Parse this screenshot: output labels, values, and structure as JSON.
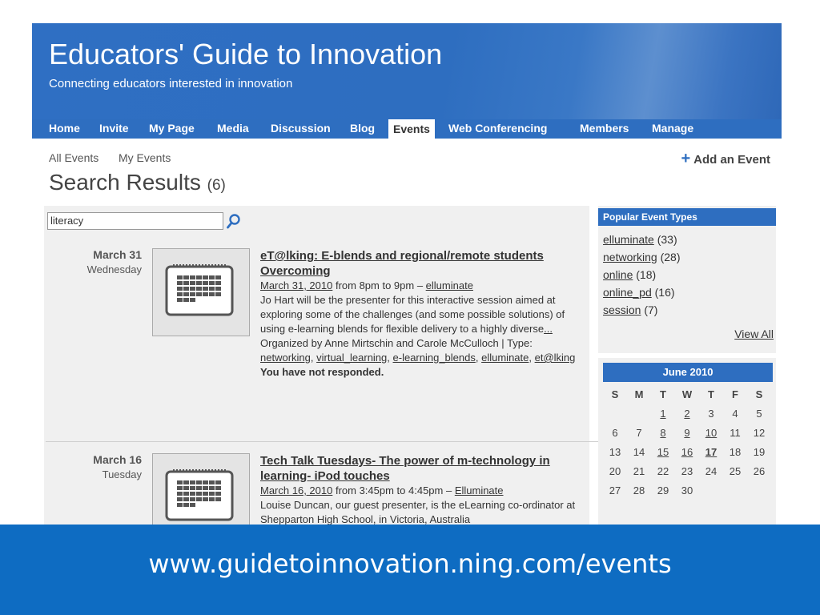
{
  "site": {
    "title": "Educators' Guide to Innovation",
    "tagline": "Connecting educators interested in innovation"
  },
  "nav": {
    "items": [
      {
        "label": "Home"
      },
      {
        "label": "Invite"
      },
      {
        "label": "My Page"
      },
      {
        "label": "Media"
      },
      {
        "label": "Discussion"
      },
      {
        "label": "Blog"
      },
      {
        "label": "Events",
        "active": true
      },
      {
        "label": "Web Conferencing"
      },
      {
        "label": "Members"
      },
      {
        "label": "Manage"
      }
    ]
  },
  "subnav": {
    "all_events": "All Events",
    "my_events": "My Events",
    "add_event": "Add an Event",
    "add_event_icon": "plus-icon"
  },
  "page": {
    "title": "Search Results",
    "count": "(6)"
  },
  "search": {
    "value": "literacy",
    "icon": "search-icon"
  },
  "events": [
    {
      "date": "March 31",
      "weekday": "Wednesday",
      "title": "eT@lking: E-blends and regional/remote students Overcoming",
      "when_link": "March 31, 2010",
      "when_text": " from 8pm to 9pm – ",
      "where_link": "elluminate",
      "description": "Jo Hart will be the presenter for this interactive session aimed at exploring some of the challenges (and some possible solutions) of using e-learning blends for flexible delivery to a highly diverse",
      "more": "...",
      "organized": "Organized by Anne Mirtschin and Carole McCulloch | Type: ",
      "types": [
        "networking",
        "virtual_learning",
        "e-learning_blends",
        "elluminate",
        "et@lking"
      ],
      "response": "You have not responded."
    },
    {
      "date": "March 16",
      "weekday": "Tuesday",
      "title": "Tech Talk Tuesdays- The power of m-technology in learning- iPod touches",
      "when_link": "March 16, 2010",
      "when_text": " from 3:45pm to 4:45pm – ",
      "where_link": "Elluminate",
      "description": "Louise Duncan, our guest presenter, is the eLearning co-ordinator at Shepparton High School, in Victoria, Australia"
    }
  ],
  "popular": {
    "heading": "Popular Event Types",
    "items": [
      {
        "name": "elluminate",
        "count": " (33)"
      },
      {
        "name": "networking",
        "count": " (28)"
      },
      {
        "name": "online",
        "count": " (18)"
      },
      {
        "name": "online_pd",
        "count": " (16)"
      },
      {
        "name": "session",
        "count": " (7)"
      }
    ],
    "view_all": "View All"
  },
  "calendar": {
    "month": "June 2010",
    "dow": [
      "S",
      "M",
      "T",
      "W",
      "T",
      "F",
      "S"
    ],
    "weeks": [
      [
        "",
        "",
        "1",
        "2",
        "3",
        "4",
        "5"
      ],
      [
        "6",
        "7",
        "8",
        "9",
        "10",
        "11",
        "12"
      ],
      [
        "13",
        "14",
        "15",
        "16",
        "17",
        "18",
        "19"
      ],
      [
        "20",
        "21",
        "22",
        "23",
        "24",
        "25",
        "26"
      ],
      [
        "27",
        "28",
        "29",
        "30",
        "",
        "",
        ""
      ]
    ],
    "linked_days": [
      "1",
      "2",
      "8",
      "9",
      "10",
      "15",
      "16",
      "17"
    ],
    "today": "17"
  },
  "banner": {
    "url": "www.guidetoinnovation.ning.com/events"
  },
  "colors": {
    "brand_blue": "#2e6ec0",
    "banner_blue": "#0e6cc2"
  }
}
